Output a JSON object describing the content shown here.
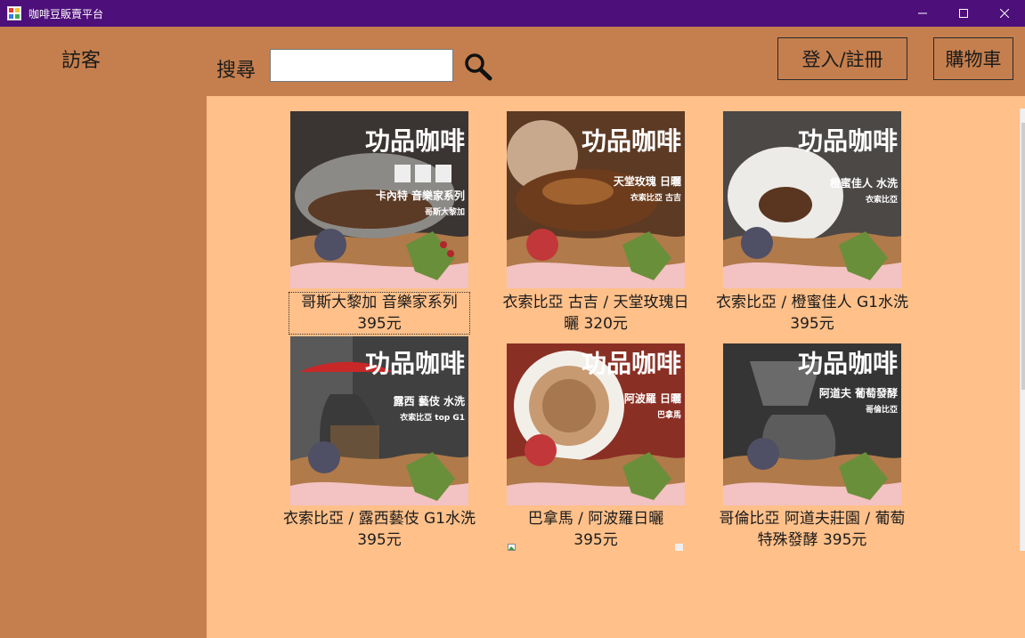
{
  "window": {
    "title": "咖啡豆販賣平台",
    "controls": [
      "minimize",
      "maximize",
      "close"
    ]
  },
  "sidebar": {
    "user_label": "訪客"
  },
  "search": {
    "label": "搜尋",
    "value": "",
    "placeholder": ""
  },
  "header": {
    "login_label": "登入/註冊",
    "cart_label": "購物車"
  },
  "banner_brand": "功品咖啡",
  "products": [
    {
      "caption": [
        "哥斯大黎加 音樂家系列",
        "395元"
      ],
      "badge_title": "卡內特 音樂家系列",
      "badge_sub": "哥斯大黎加",
      "bg": "#3a3532"
    },
    {
      "caption": [
        "衣索比亞 古吉 / 天堂玫瑰日",
        "曬 320元"
      ],
      "badge_title": "天堂玫瑰 日曬",
      "badge_sub": "衣索比亞 古吉",
      "bg": "#5c3a24"
    },
    {
      "caption": [
        "衣索比亞 / 橙蜜佳人 G1水洗",
        "395元"
      ],
      "badge_title": "橙蜜佳人 水洗",
      "badge_sub": "衣索比亞",
      "bg": "#4b4846"
    },
    {
      "caption": [
        "衣索比亞 / 露西藝伎 G1水洗",
        "395元"
      ],
      "badge_title": "露西 藝伎 水洗",
      "badge_sub": "衣索比亞 top G1",
      "bg": "#404040"
    },
    {
      "caption": [
        "巴拿馬 / 阿波羅日曬",
        "395元"
      ],
      "badge_title": "阿波羅 日曬",
      "badge_sub": "巴拿馬",
      "bg": "#8a2f24"
    },
    {
      "caption": [
        "哥倫比亞 阿道夫莊園 / 葡萄",
        "特殊發酵 395元"
      ],
      "badge_title": "阿道夫 葡萄發酵",
      "badge_sub": "哥倫比亞",
      "bg": "#353535"
    }
  ]
}
